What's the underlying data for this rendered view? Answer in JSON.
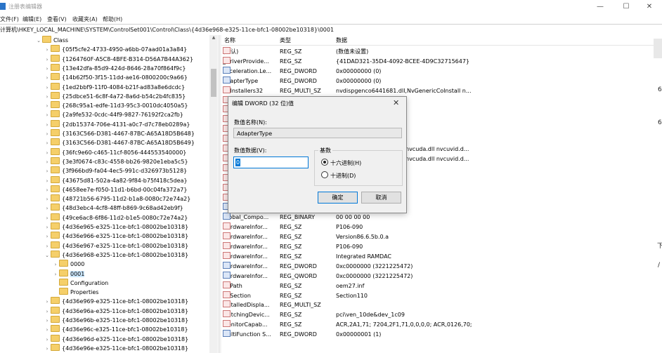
{
  "window": {
    "title": "注册表编辑器",
    "min": "—",
    "max": "☐",
    "close": "✕"
  },
  "menu": [
    {
      "label": "文件(F)"
    },
    {
      "label": "编辑(E)"
    },
    {
      "label": "查看(V)"
    },
    {
      "label": "收藏夹(A)"
    },
    {
      "label": "帮助(H)"
    }
  ],
  "address": "计算机\\HKEY_LOCAL_MACHINE\\SYSTEM\\ControlSet001\\Control\\Class\\{4d36e968-e325-11ce-bfc1-08002be10318}\\0001",
  "tree": {
    "root": "Class",
    "items": [
      "{05f5cfe2-4733-4950-a6bb-07aad01a3a84}",
      "{1264760F-A5C8-4BFE-B314-D56A7B44A362}",
      "{13e42dfa-85d9-424d-8646-28a70f864f9c}",
      "{14b62f50-3f15-11dd-ae16-0800200c9a66}",
      "{1ed2bbf9-11f0-4084-b21f-ad83a8e6dcdc}",
      "{25dbce51-6c8f-4a72-8a6d-b54c2b4fc835}",
      "{268c95a1-edfe-11d3-95c3-0010dc4050a5}",
      "{2a9fe532-0cdc-44f9-9827-76192f2ca2fb}",
      "{2db15374-706e-4131-a0c7-d7c78eb0289a}",
      "{3163C566-D381-4467-87BC-A65A18D5B648}",
      "{3163C566-D381-4467-87BC-A65A18D5B649}",
      "{36fc9e60-c465-11cf-8056-444553540000}",
      "{3e3f0674-c83c-4558-bb26-9820e1eba5c5}",
      "{3f966bd9-fa04-4ec5-991c-d326973b5128}",
      "{43675d81-502a-4a82-9f84-b75f418c5dea}",
      "{4658ee7e-f050-11d1-b6bd-00c04fa372a7}",
      "{48721b56-6795-11d2-b1a8-0080c72e74a2}",
      "{48d3ebc4-4cf8-48ff-b869-9c68ad42eb9f}",
      "{49ce6ac8-6f86-11d2-b1e5-0080c72e74a2}",
      "{4d36e965-e325-11ce-bfc1-08002be10318}",
      "{4d36e966-e325-11ce-bfc1-08002be10318}",
      "{4d36e967-e325-11ce-bfc1-08002be10318}",
      "{4d36e968-e325-11ce-bfc1-08002be10318}"
    ],
    "children": [
      "0000",
      "0001",
      "Configuration",
      "Properties"
    ],
    "after": [
      "{4d36e969-e325-11ce-bfc1-08002be10318}",
      "{4d36e96a-e325-11ce-bfc1-08002be10318}",
      "{4d36e96b-e325-11ce-bfc1-08002be10318}",
      "{4d36e96c-e325-11ce-bfc1-08002be10318}",
      "{4d36e96d-e325-11ce-bfc1-08002be10318}",
      "{4d36e96e-e325-11ce-bfc1-08002be10318}"
    ]
  },
  "list": {
    "headers": {
      "name": "名称",
      "type": "类型",
      "data": "数据"
    },
    "rows": [
      {
        "icon": "sz",
        "name": "(默认)",
        "type": "REG_SZ",
        "data": "(数值未设置)"
      },
      {
        "icon": "sz",
        "name": "_DriverProvide...",
        "type": "REG_SZ",
        "data": "{41DAD321-35D4-4092-BCEE-4D9C32715647}"
      },
      {
        "icon": "bin",
        "name": "Acceleration.Le...",
        "type": "REG_DWORD",
        "data": "0x00000000 (0)"
      },
      {
        "icon": "bin",
        "name": "AdapterType",
        "type": "REG_DWORD",
        "data": "0x00000000 (0)"
      },
      {
        "icon": "sz",
        "name": "CoInstallers32",
        "type": "REG_MULTI_SZ",
        "data": "nvdispgenco6441681.dll,NvGenericCoInstall n..."
      },
      {
        "icon": "sz",
        "name": "",
        "type": "",
        "data": ""
      },
      {
        "icon": "sz",
        "name": "",
        "type": "",
        "data": ""
      },
      {
        "icon": "sz",
        "name": "",
        "type": "",
        "data": ""
      },
      {
        "icon": "sz",
        "name": "",
        "type": "",
        "data": ""
      },
      {
        "icon": "sz",
        "name": "",
        "type": "",
        "data": ""
      },
      {
        "icon": "sz",
        "name": "",
        "type": "",
        "data": "nvcuda.dll nvcuvid.d..."
      },
      {
        "icon": "sz",
        "name": "",
        "type": "",
        "data": "nvcuda.dll nvcuvid.d..."
      },
      {
        "icon": "sz",
        "name": "",
        "type": "",
        "data": ""
      },
      {
        "icon": "sz",
        "name": "",
        "type": "",
        "data": ""
      },
      {
        "icon": "sz",
        "name": "",
        "type": "",
        "data": ""
      },
      {
        "icon": "sz",
        "name": "",
        "type": "",
        "data": ""
      },
      {
        "icon": "bin",
        "name": "FeatureScore",
        "type": "REG_DWORD",
        "data": "0x000000d1 (209)"
      },
      {
        "icon": "bin",
        "name": "Global_Compo...",
        "type": "REG_BINARY",
        "data": "00 00 00 00"
      },
      {
        "icon": "sz",
        "name": "HardwareInfor...",
        "type": "REG_SZ",
        "data": "P106-090"
      },
      {
        "icon": "sz",
        "name": "HardwareInfor...",
        "type": "REG_SZ",
        "data": "Version86.6.5b.0.a"
      },
      {
        "icon": "sz",
        "name": "HardwareInfor...",
        "type": "REG_SZ",
        "data": "P106-090"
      },
      {
        "icon": "sz",
        "name": "HardwareInfor...",
        "type": "REG_SZ",
        "data": "Integrated RAMDAC"
      },
      {
        "icon": "bin",
        "name": "HardwareInfor...",
        "type": "REG_DWORD",
        "data": "0xc0000000 (3221225472)"
      },
      {
        "icon": "bin",
        "name": "HardwareInfor...",
        "type": "REG_QWORD",
        "data": "0xc0000000 (3221225472)"
      },
      {
        "icon": "sz",
        "name": "InfPath",
        "type": "REG_SZ",
        "data": "oem27.inf"
      },
      {
        "icon": "sz",
        "name": "InfSection",
        "type": "REG_SZ",
        "data": "Section110"
      },
      {
        "icon": "sz",
        "name": "InstalledDispla...",
        "type": "REG_MULTI_SZ",
        "data": ""
      },
      {
        "icon": "sz",
        "name": "MatchingDevic...",
        "type": "REG_SZ",
        "data": "pci\\ven_10de&dev_1c09"
      },
      {
        "icon": "sz",
        "name": "MonitorCapab...",
        "type": "REG_SZ",
        "data": "ACR,2A1,71; 7204,2F1,71,0,0,0,0; ACR,0126,70;"
      },
      {
        "icon": "bin",
        "name": "MultiFunction S...",
        "type": "REG_DWORD",
        "data": "0x00000001 (1)"
      }
    ]
  },
  "dialog": {
    "title": "编辑 DWORD (32 位)值",
    "close": "✕",
    "name_label": "数值名称(N):",
    "name_value": "AdapterType",
    "data_label": "数值数据(V):",
    "data_value": "0",
    "base_label": "基数",
    "hex_label": "十六进制(H)",
    "dec_label": "十进制(D)",
    "ok": "确定",
    "cancel": "取消"
  },
  "side_fragments": [
    "6",
    "6",
    "下",
    "/"
  ]
}
